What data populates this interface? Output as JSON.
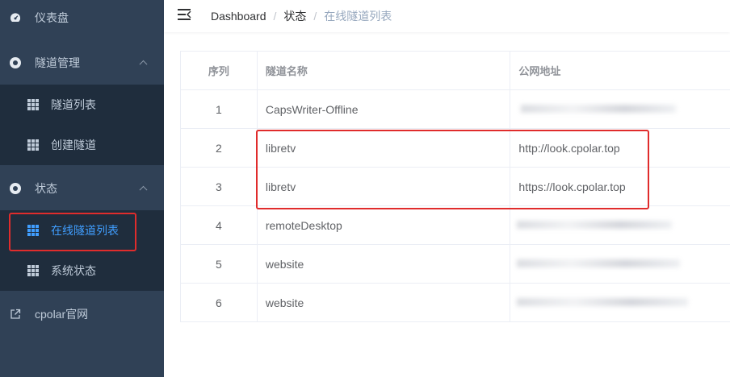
{
  "sidebar": {
    "dashboard": "仪表盘",
    "tunnel_mgmt": "隧道管理",
    "tunnel_list": "隧道列表",
    "create_tunnel": "创建隧道",
    "status": "状态",
    "online_tunnels": "在线隧道列表",
    "system_status": "系统状态",
    "cpolar_site": "cpolar官网"
  },
  "breadcrumb": {
    "home": "Dashboard",
    "sep": "/",
    "parent": "状态",
    "current": "在线隧道列表"
  },
  "table": {
    "headers": [
      "序列",
      "隧道名称",
      "公网地址"
    ],
    "rows": [
      {
        "index": "1",
        "name": "CapsWriter-Offline",
        "url": "",
        "blurred": true
      },
      {
        "index": "2",
        "name": "libretv",
        "url": "http://look.cpolar.top",
        "blurred": false
      },
      {
        "index": "3",
        "name": "libretv",
        "url": "https://look.cpolar.top",
        "blurred": false
      },
      {
        "index": "4",
        "name": "remoteDesktop",
        "url": "",
        "blurred": true
      },
      {
        "index": "5",
        "name": "website",
        "url": "",
        "blurred": true
      },
      {
        "index": "6",
        "name": "website",
        "url": "",
        "blurred": true
      }
    ]
  },
  "colors": {
    "sidebar_bg": "#304156",
    "submenu_bg": "#1f2d3d",
    "active": "#409eff",
    "highlight": "#e02c2c"
  }
}
